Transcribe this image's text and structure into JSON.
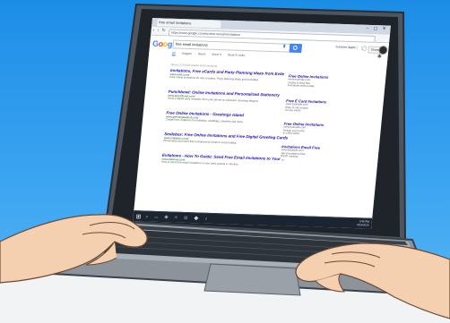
{
  "browser": {
    "tab_title": "free email invitations",
    "url": "https://www.google.com/#q=free+email+invitations",
    "nav_icons": "‹ › ↻",
    "window_controls": "– ▢ ✕"
  },
  "google": {
    "logo_letters": [
      "G",
      "o",
      "o",
      "g",
      "l",
      "e"
    ],
    "logo_colors": [
      "#4285f4",
      "#ea4335",
      "#fbbc05",
      "#4285f4",
      "#34a853",
      "#ea4335"
    ],
    "query": "free email invitations",
    "tabs": [
      "All",
      "Images",
      "News",
      "More ▾",
      "Search tools"
    ],
    "active_tab": 0,
    "account_text": "Summer Apple",
    "share_label": "Share",
    "results_stats": "About 2,010,000 results (0.52 seconds)"
  },
  "results": [
    {
      "title": "Invitations, Free eCards and Party Planning Ideas from Evite",
      "url": "www.evite.com/",
      "snippet": "Free online invitations for any occasion. Party planning ideas and printables."
    },
    {
      "title": "Punchbowl: Online Invitations and Personalized Stationery",
      "url": "www.punchbowl.com/",
      "snippet": "Send a digital party invitation from your phone or computer. Stunning designs."
    },
    {
      "title": "Free Online Invitations - Greetings Island",
      "url": "www.greetingsisland.com/",
      "snippet": "Create free invitations for birthdays, weddings, showers and more."
    },
    {
      "title": "Smilebox: Free Online Invitations and Free Digital Greeting Cards",
      "url": "www.smilebox.com/",
      "snippet": "Personalize and send free invitations by email or social media."
    },
    {
      "title": "Evitations - How To Guide: Send Free Email Invitations to Your ...",
      "url": "www.wikihow.com/",
      "snippet": "How to send free email invitations to your party guests in minutes."
    }
  ],
  "ads": [
    {
      "title": "Free Online Invitations",
      "lines": [
        "www.example.com",
        "Create & send free",
        "invitations online today"
      ]
    },
    {
      "title": "Free E Card Invitations",
      "lines": [
        "www.example.com",
        "Easy to use ecards",
        "for any event"
      ]
    },
    {
      "title": "Free Online Invitations",
      "lines": [
        "www.example.com",
        "Design your invite",
        "in a few clicks"
      ]
    },
    {
      "title": "Invitations Email Free",
      "lines": [
        "www.example.com",
        "Send invitations free",
        "RSVP tracking"
      ]
    }
  ],
  "taskbar": {
    "start": "⊞",
    "apps": "⌕ ▭ ◉ ✉ ▤ ◆ ♪",
    "time": "3:45 PM",
    "date": "5/15/2016"
  }
}
